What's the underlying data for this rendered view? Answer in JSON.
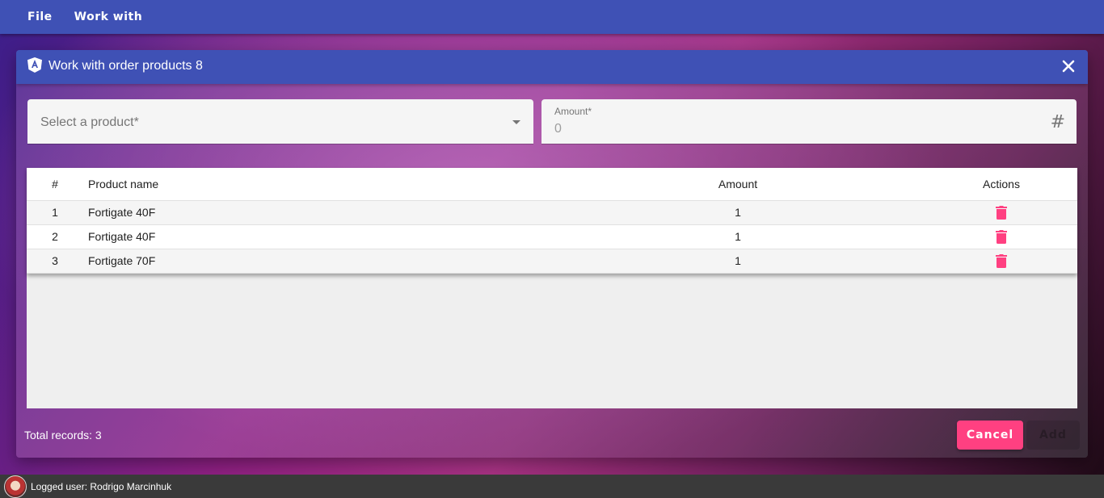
{
  "menu": {
    "items": [
      "File",
      "Work with"
    ]
  },
  "dialog": {
    "title": "Work with order products 8",
    "product_select": {
      "placeholder": "Select a product*"
    },
    "amount_field": {
      "label": "Amount*",
      "value": "0"
    },
    "table": {
      "headers": {
        "num": "#",
        "name": "Product name",
        "amount": "Amount",
        "actions": "Actions"
      },
      "rows": [
        {
          "num": "1",
          "name": "Fortigate 40F",
          "amount": "1"
        },
        {
          "num": "2",
          "name": "Fortigate 40F",
          "amount": "1"
        },
        {
          "num": "3",
          "name": "Fortigate 70F",
          "amount": "1"
        }
      ]
    },
    "total_records": "Total records: 3",
    "cancel_label": "Cancel",
    "add_label": "Add"
  },
  "status": {
    "logged_user": "Logged user: Rodrigo Marcinhuk"
  },
  "colors": {
    "primary": "#3f51b5",
    "accent": "#ff4081"
  },
  "icons": {
    "dialog": "angular-shield-icon",
    "close": "close-icon",
    "amount": "hash-icon",
    "row_action": "trash-icon",
    "select": "dropdown-arrow-icon"
  }
}
